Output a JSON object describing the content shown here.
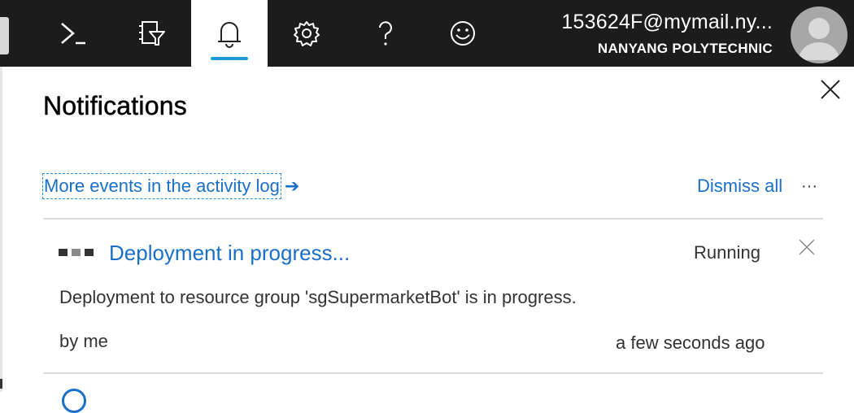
{
  "topbar": {
    "icons": [
      {
        "name": "cloud-shell-icon",
        "active": false
      },
      {
        "name": "directory-filter-icon",
        "active": false
      },
      {
        "name": "notifications-bell-icon",
        "active": true
      },
      {
        "name": "settings-gear-icon",
        "active": false
      },
      {
        "name": "help-question-icon",
        "active": false
      },
      {
        "name": "feedback-smiley-icon",
        "active": false
      }
    ],
    "accent_color": "#1e9bd7",
    "account": {
      "email": "153624F@mymail.ny...",
      "org": "NANYANG POLYTECHNIC"
    }
  },
  "panel": {
    "title": "Notifications",
    "activity_link": "More events in the activity log",
    "activity_arrow": "➔",
    "dismiss_all": "Dismiss all",
    "more": "···",
    "link_color": "#1a6fc9"
  },
  "notification": {
    "title": "Deployment in progress...",
    "status": "Running",
    "description": "Deployment to resource group 'sgSupermarketBot' is in progress.",
    "by": "by me",
    "time": "a few seconds ago"
  }
}
